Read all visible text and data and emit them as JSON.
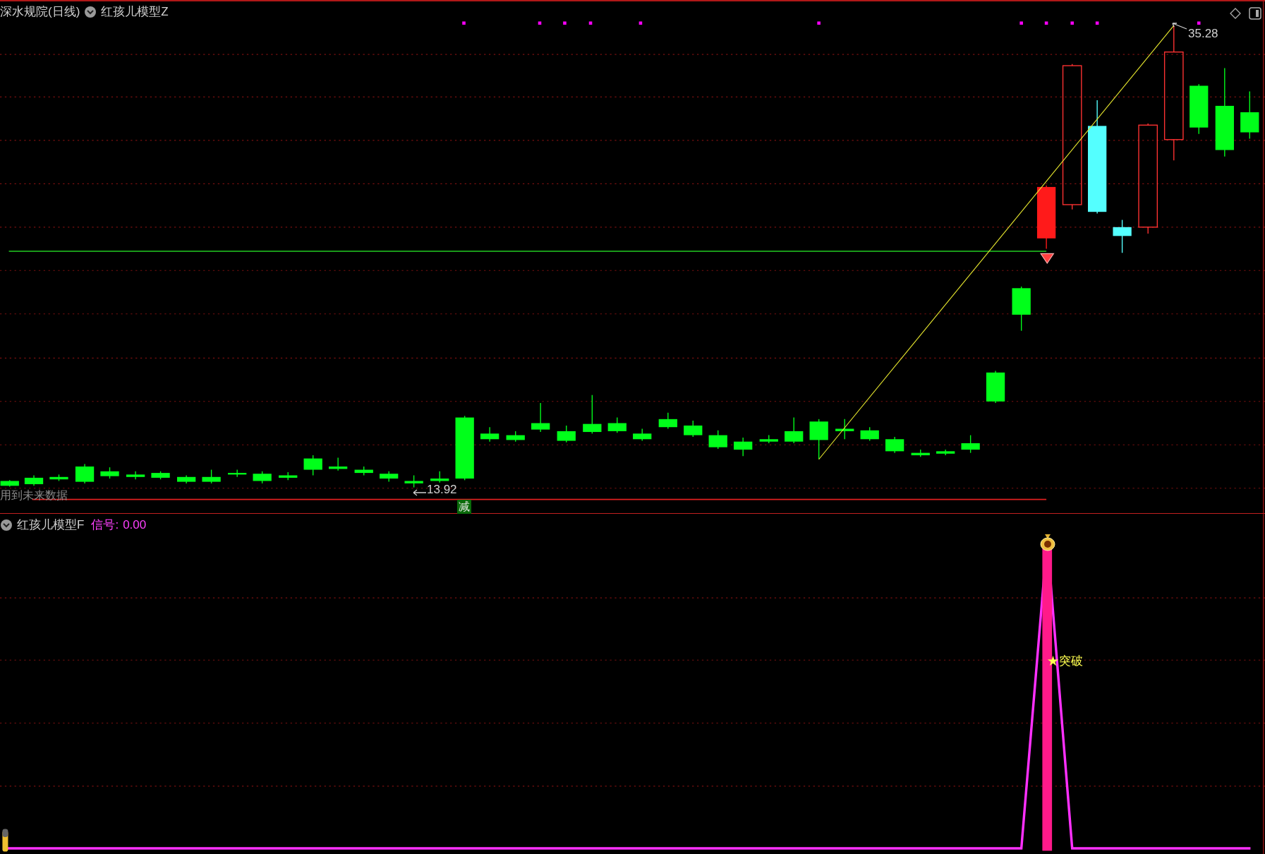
{
  "main_panel": {
    "title": "深水规院(日线)",
    "indicator": "红孩儿模型Z",
    "future_data_note": "用到未来数据",
    "low_label": "13.92",
    "high_label": "35.28",
    "signal_badge": "减"
  },
  "signal_panel": {
    "indicator": "红孩儿模型F",
    "signal_label": "信号:",
    "signal_value": "0.00",
    "marker_label": "★突破"
  }
}
